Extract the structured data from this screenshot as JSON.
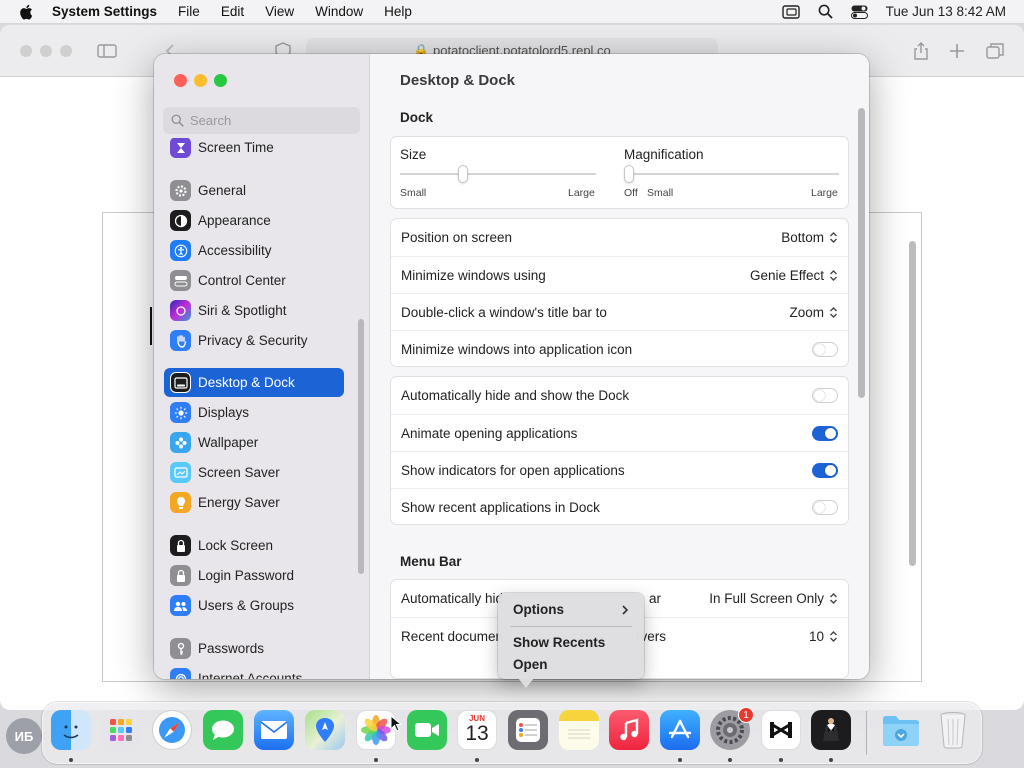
{
  "menubar": {
    "app_name": "System Settings",
    "items": [
      "File",
      "Edit",
      "View",
      "Window",
      "Help"
    ],
    "clock": "Tue Jun 13  8:42 AM"
  },
  "browser": {
    "url": "potatoclient.potatolord5.repl.co"
  },
  "search": {
    "placeholder": "Search"
  },
  "sidebar": {
    "items": [
      {
        "label": "Screen Time",
        "icon": "hourglass-icon",
        "color": "#6e4ad6"
      },
      {
        "label": "General",
        "icon": "gear-icon",
        "color": "#8e8e93"
      },
      {
        "label": "Appearance",
        "icon": "appearance-icon",
        "color": "#1c1c1e"
      },
      {
        "label": "Accessibility",
        "icon": "accessibility-icon",
        "color": "#1f7cf4"
      },
      {
        "label": "Control Center",
        "icon": "control-center-icon",
        "color": "#8e8e93"
      },
      {
        "label": "Siri & Spotlight",
        "icon": "siri-icon",
        "color": "#7b2ad6"
      },
      {
        "label": "Privacy & Security",
        "icon": "hand-icon",
        "color": "#2f7df7"
      },
      {
        "label": "Desktop & Dock",
        "icon": "dock-icon",
        "color": "#1c1c1e"
      },
      {
        "label": "Displays",
        "icon": "sun-icon",
        "color": "#2f7df7"
      },
      {
        "label": "Wallpaper",
        "icon": "flower-icon",
        "color": "#39a7f0"
      },
      {
        "label": "Screen Saver",
        "icon": "screen-saver-icon",
        "color": "#5ac8fa"
      },
      {
        "label": "Energy Saver",
        "icon": "battery-icon",
        "color": "#f5a623"
      },
      {
        "label": "Lock Screen",
        "icon": "lock-icon",
        "color": "#1c1c1e"
      },
      {
        "label": "Login Password",
        "icon": "padlock-icon",
        "color": "#8e8e93"
      },
      {
        "label": "Users & Groups",
        "icon": "users-icon",
        "color": "#2f7df7"
      },
      {
        "label": "Passwords",
        "icon": "key-icon",
        "color": "#8e8e93"
      },
      {
        "label": "Internet Accounts",
        "icon": "at-icon",
        "color": "#2f7df7"
      }
    ]
  },
  "content": {
    "title": "Desktop & Dock",
    "dock_section": "Dock",
    "size_label": "Size",
    "size_small": "Small",
    "size_large": "Large",
    "size_value": 0.32,
    "mag_label": "Magnification",
    "mag_off": "Off",
    "mag_small": "Small",
    "mag_large": "Large",
    "mag_value": 0.0,
    "rows1": [
      {
        "label": "Position on screen",
        "value": "Bottom"
      },
      {
        "label": "Minimize windows using",
        "value": "Genie Effect"
      },
      {
        "label": "Double-click a window's title bar to",
        "value": "Zoom"
      },
      {
        "label": "Minimize windows into application icon",
        "toggle": false
      }
    ],
    "rows2": [
      {
        "label": "Automatically hide and show the Dock",
        "toggle": false
      },
      {
        "label": "Animate opening applications",
        "toggle": true
      },
      {
        "label": "Show indicators for open applications",
        "toggle": true
      },
      {
        "label": "Show recent applications in Dock",
        "toggle": false
      }
    ],
    "menubar_section": "Menu Bar",
    "rows3": [
      {
        "label_left": "Automatically hid",
        "label_right": "ar",
        "value": "In Full Screen Only"
      },
      {
        "label_left": "Recent documen",
        "label_right": "rvers",
        "value": "10"
      }
    ]
  },
  "context_menu": {
    "items": [
      "Options",
      "Show Recents",
      "Open"
    ]
  },
  "dock": {
    "calendar_month": "JUN",
    "calendar_day": "13",
    "settings_badge": "1",
    "avatar_initials": "ИБ"
  }
}
